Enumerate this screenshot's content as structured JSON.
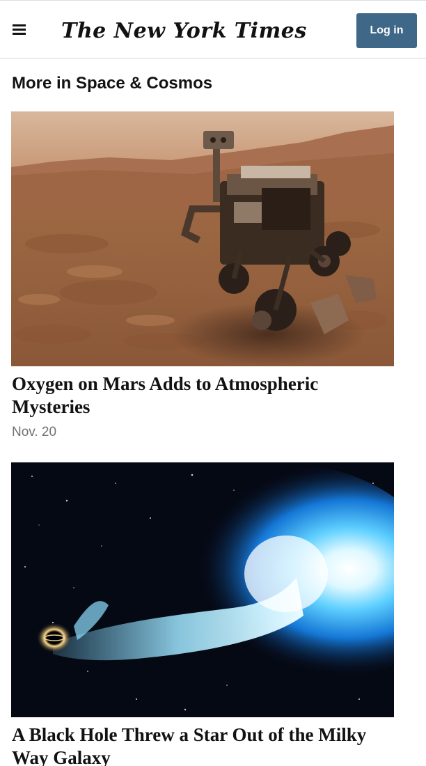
{
  "header": {
    "logo_text": "The New York Times",
    "login_label": "Log in"
  },
  "section": {
    "title": "More in Space & Cosmos"
  },
  "stories": [
    {
      "headline": "Oxygen on Mars Adds to Atmospheric Mysteries",
      "date": "Nov. 20",
      "image_subject": "mars-rover-selfie"
    },
    {
      "headline": "A Black Hole Threw a Star Out of the Milky Way Galaxy",
      "image_subject": "black-hole-star-ejection"
    }
  ],
  "colors": {
    "login_button": "#3f6788",
    "text": "#121212",
    "date": "#727272"
  }
}
